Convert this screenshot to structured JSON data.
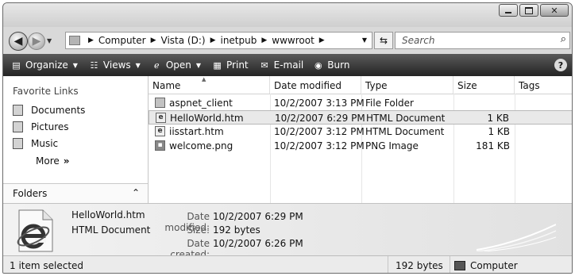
{
  "address": {
    "crumbs": [
      "Computer",
      "Vista (D:)",
      "inetpub",
      "wwwroot"
    ],
    "search_placeholder": "Search"
  },
  "toolbar": {
    "organize": "Organize",
    "views": "Views",
    "open": "Open",
    "print": "Print",
    "email": "E-mail",
    "burn": "Burn",
    "help": "?"
  },
  "nav": {
    "favorites_title": "Favorite Links",
    "items": [
      "Documents",
      "Pictures",
      "Music"
    ],
    "more": "More",
    "more_arrow": "»",
    "folders": "Folders"
  },
  "list": {
    "columns": [
      "Name",
      "Date modified",
      "Type",
      "Size",
      "Tags"
    ],
    "rows": [
      {
        "icon": "folder-icon",
        "name": "aspnet_client",
        "date": "10/2/2007 3:13 PM",
        "type": "File Folder",
        "size": "",
        "selected": false
      },
      {
        "icon": "html-document-icon",
        "name": "HelloWorld.htm",
        "date": "10/2/2007 6:29 PM",
        "type": "HTML Document",
        "size": "1 KB",
        "selected": true
      },
      {
        "icon": "html-document-icon",
        "name": "iisstart.htm",
        "date": "10/2/2007 3:12 PM",
        "type": "HTML Document",
        "size": "1 KB",
        "selected": false
      },
      {
        "icon": "png-image-icon",
        "name": "welcome.png",
        "date": "10/2/2007 3:12 PM",
        "type": "PNG Image",
        "size": "181 KB",
        "selected": false
      }
    ]
  },
  "details": {
    "name": "HelloWorld.htm",
    "type": "HTML Document",
    "date_modified_label": "Date modified:",
    "date_modified": "10/2/2007 6:29 PM",
    "size_label": "Size:",
    "size": "192 bytes",
    "date_created_label": "Date created:",
    "date_created": "10/2/2007 6:26 PM"
  },
  "status": {
    "selection": "1 item selected",
    "size": "192 bytes",
    "location": "Computer"
  }
}
